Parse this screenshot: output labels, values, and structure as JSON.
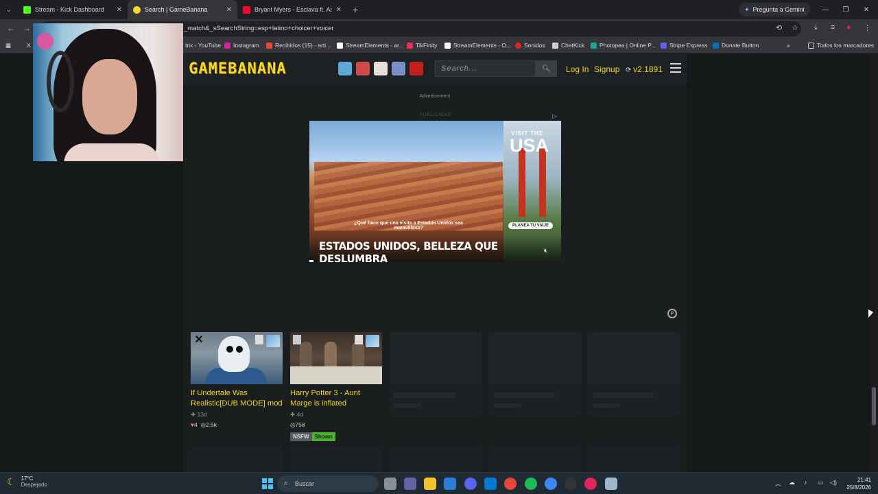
{
  "browser": {
    "tabs": [
      {
        "title": "Stream - Kick Dashboard",
        "favicon_color": "#53fc18",
        "active": false
      },
      {
        "title": "Search | GameBanana",
        "favicon_color": "#f4d82b",
        "active": true
      },
      {
        "title": "Bryant Myers - Esclava ft. Anonim",
        "favicon_color": "#ff0033",
        "active": false
      }
    ],
    "new_tab": "+",
    "gemini_label": "Pregunta a Gemini",
    "url": "_match&_sSearchString=esp+latino+choicer+voicer",
    "bookmarks": [
      {
        "label": "trix - YouTube",
        "color": "#ff0033"
      },
      {
        "label": "Instagram",
        "color": "#d6249f"
      },
      {
        "label": "Recibidos (15) - arti...",
        "color": "#ea4335"
      },
      {
        "label": "StreamElements - ar...",
        "color": "#ffffff"
      },
      {
        "label": "TikFinity",
        "color": "#fe2c55"
      },
      {
        "label": "StreamElements - O...",
        "color": "#ffffff"
      },
      {
        "label": "Sonidos",
        "color": "#e02424"
      },
      {
        "label": "ChatKick",
        "color": "#cccccc"
      },
      {
        "label": "Photopea | Online P...",
        "color": "#18a497"
      },
      {
        "label": "Stripe Express",
        "color": "#635bff"
      },
      {
        "label": "Donate Button",
        "color": "#0070ba"
      }
    ],
    "all_bookmarks": "Todos los marcadores"
  },
  "gamebanana": {
    "logo": "GAMEBANANA",
    "search_placeholder": "Search...",
    "login": "Log In",
    "signup": "Signup",
    "version": "v2.1891",
    "game_icon_colors": [
      "#5ea8d8",
      "#d14a4a",
      "#e8e0d8",
      "#7a8fc8",
      "#c42020"
    ]
  },
  "ad": {
    "label": "Advertisement",
    "publicidad": "PUBLICIDAD",
    "visit": "VISIT THE",
    "usa": "USA",
    "question": "¿Qué hace que una visita a Estados Unidos sea maravillosa?",
    "cta": "PLANEA TU VIAJE",
    "headline": "ESTADOS UNIDOS, BELLEZA QUE DESLUMBRA"
  },
  "results": [
    {
      "title": "If Undertale Was Realistic[DUB MODE] mod",
      "age": "13d",
      "likes": "4",
      "views": "2.5k"
    },
    {
      "title": "Harry Potter 3 - Aunt Marge is inflated",
      "age": "4d",
      "views": "758",
      "tags": [
        "NSFW",
        "Shown"
      ]
    }
  ],
  "taskbar": {
    "temp": "17°C",
    "weather": "Despejado",
    "search": "Buscar",
    "time": "21:41",
    "date": "25/8/2026",
    "app_colors": [
      "#8a8f95",
      "#6264a7",
      "#f4c430",
      "#2d7cd6",
      "#5865f2",
      "#0078d4",
      "#e8453c",
      "#1db954",
      "#4285f4",
      "#333333",
      "#e0245e",
      "#9ab8c8"
    ]
  }
}
